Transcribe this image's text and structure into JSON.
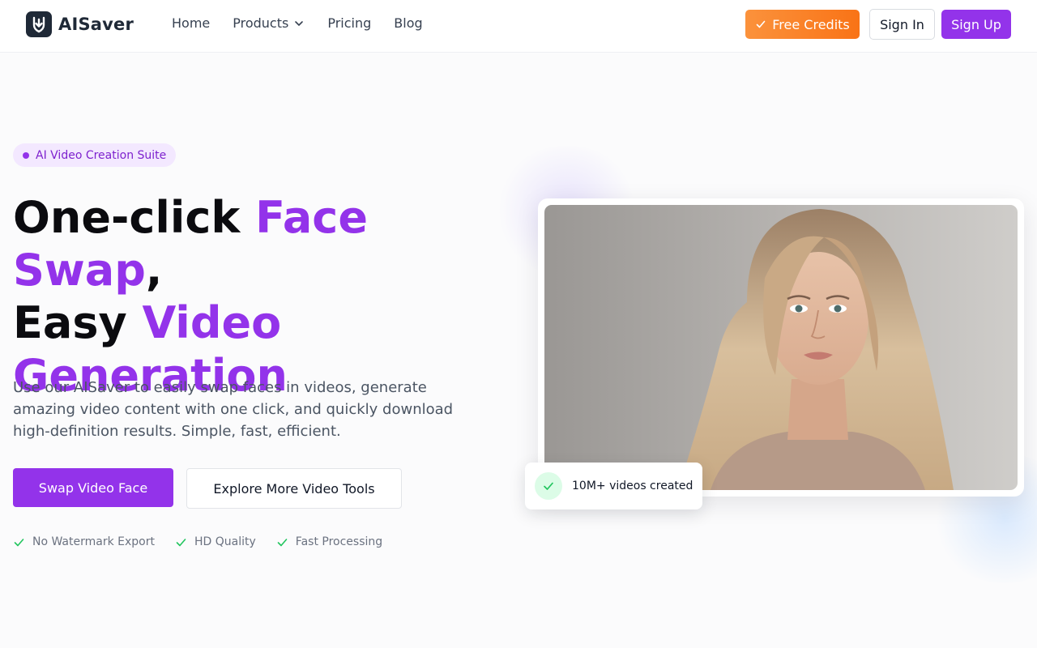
{
  "brand": {
    "name": "AISaver",
    "logo_icon": "download-shield-icon"
  },
  "nav": {
    "items": [
      {
        "label": "Home"
      },
      {
        "label": "Products",
        "has_dropdown": true
      },
      {
        "label": "Pricing"
      },
      {
        "label": "Blog"
      }
    ]
  },
  "actions": {
    "credits_label": "Free Credits",
    "signin_label": "Sign In",
    "signup_label": "Sign Up"
  },
  "hero": {
    "badge": "AI Video Creation Suite",
    "headline": {
      "part1": "One-click ",
      "part2": "Face Swap",
      "part3": ",",
      "part4": "Easy ",
      "part5": "Video",
      "part6": "Generation"
    },
    "description": "Use our AISaver to easily swap faces in videos, generate amazing video content with one click, and quickly download high-definition results. Simple, fast, efficient.",
    "primary_cta": "Swap Video Face",
    "secondary_cta": "Explore More Video Tools",
    "features": [
      "No Watermark Export",
      "HD Quality",
      "Fast Processing"
    ]
  },
  "showcase": {
    "stat_label": "10M+ videos created"
  },
  "colors": {
    "accent": "#9333ea",
    "orange": "#f97316",
    "check_green": "#22c55e"
  }
}
